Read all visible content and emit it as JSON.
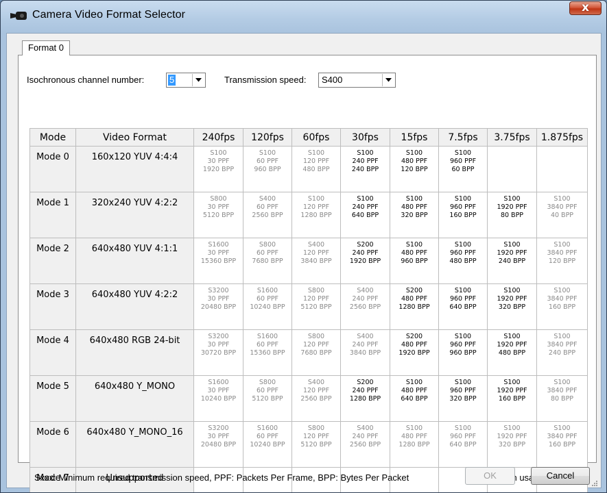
{
  "window": {
    "title": "Camera Video Format Selector",
    "close_glyph": "x"
  },
  "tabs": [
    {
      "label": "Format 0"
    }
  ],
  "isochronous": {
    "label": "Isochronous channel number:",
    "value": "5"
  },
  "transmission": {
    "label": "Transmission speed:",
    "value": "S400"
  },
  "table": {
    "headers": [
      "Mode",
      "Video Format",
      "240fps",
      "120fps",
      "60fps",
      "30fps",
      "15fps",
      "7.5fps",
      "3.75fps",
      "1.875fps"
    ],
    "rows": [
      {
        "mode": "Mode 0",
        "format": "160x120 YUV 4:4:4",
        "cells": [
          {
            "speed": "S100",
            "ppf": "30 PPF",
            "bpp": "1920 BPP",
            "supported": false
          },
          {
            "speed": "S100",
            "ppf": "60 PPF",
            "bpp": "960 BPP",
            "supported": false
          },
          {
            "speed": "S100",
            "ppf": "120 PPF",
            "bpp": "480 BPP",
            "supported": false
          },
          {
            "speed": "S100",
            "ppf": "240 PPF",
            "bpp": "240 BPP",
            "supported": true
          },
          {
            "speed": "S100",
            "ppf": "480 PPF",
            "bpp": "120 BPP",
            "supported": true
          },
          {
            "speed": "S100",
            "ppf": "960 PPF",
            "bpp": "60 BPP",
            "supported": true
          },
          null,
          null
        ]
      },
      {
        "mode": "Mode 1",
        "format": "320x240 YUV 4:2:2",
        "cells": [
          {
            "speed": "S800",
            "ppf": "30 PPF",
            "bpp": "5120 BPP",
            "supported": false
          },
          {
            "speed": "S400",
            "ppf": "60 PPF",
            "bpp": "2560 BPP",
            "supported": false
          },
          {
            "speed": "S100",
            "ppf": "120 PPF",
            "bpp": "1280 BPP",
            "supported": false
          },
          {
            "speed": "S100",
            "ppf": "240 PPF",
            "bpp": "640 BPP",
            "supported": true
          },
          {
            "speed": "S100",
            "ppf": "480 PPF",
            "bpp": "320 BPP",
            "supported": true
          },
          {
            "speed": "S100",
            "ppf": "960 PPF",
            "bpp": "160 BPP",
            "supported": true
          },
          {
            "speed": "S100",
            "ppf": "1920 PPF",
            "bpp": "80 BPP",
            "supported": true
          },
          {
            "speed": "S100",
            "ppf": "3840 PPF",
            "bpp": "40 BPP",
            "supported": false
          }
        ]
      },
      {
        "mode": "Mode 2",
        "format": "640x480 YUV 4:1:1",
        "cells": [
          {
            "speed": "S1600",
            "ppf": "30 PPF",
            "bpp": "15360 BPP",
            "supported": false
          },
          {
            "speed": "S800",
            "ppf": "60 PPF",
            "bpp": "7680 BPP",
            "supported": false
          },
          {
            "speed": "S400",
            "ppf": "120 PPF",
            "bpp": "3840 BPP",
            "supported": false
          },
          {
            "speed": "S200",
            "ppf": "240 PPF",
            "bpp": "1920 BPP",
            "supported": true
          },
          {
            "speed": "S100",
            "ppf": "480 PPF",
            "bpp": "960 BPP",
            "supported": true
          },
          {
            "speed": "S100",
            "ppf": "960 PPF",
            "bpp": "480 BPP",
            "supported": true
          },
          {
            "speed": "S100",
            "ppf": "1920 PPF",
            "bpp": "240 BPP",
            "supported": true
          },
          {
            "speed": "S100",
            "ppf": "3840 PPF",
            "bpp": "120 BPP",
            "supported": false
          }
        ]
      },
      {
        "mode": "Mode 3",
        "format": "640x480 YUV 4:2:2",
        "cells": [
          {
            "speed": "S3200",
            "ppf": "30 PPF",
            "bpp": "20480 BPP",
            "supported": false
          },
          {
            "speed": "S1600",
            "ppf": "60 PPF",
            "bpp": "10240 BPP",
            "supported": false
          },
          {
            "speed": "S800",
            "ppf": "120 PPF",
            "bpp": "5120 BPP",
            "supported": false
          },
          {
            "speed": "S400",
            "ppf": "240 PPF",
            "bpp": "2560 BPP",
            "supported": false
          },
          {
            "speed": "S200",
            "ppf": "480 PPF",
            "bpp": "1280 BPP",
            "supported": true
          },
          {
            "speed": "S100",
            "ppf": "960 PPF",
            "bpp": "640 BPP",
            "supported": true
          },
          {
            "speed": "S100",
            "ppf": "1920 PPF",
            "bpp": "320 BPP",
            "supported": true
          },
          {
            "speed": "S100",
            "ppf": "3840 PPF",
            "bpp": "160 BPP",
            "supported": false
          }
        ]
      },
      {
        "mode": "Mode 4",
        "format": "640x480 RGB 24-bit",
        "cells": [
          {
            "speed": "S3200",
            "ppf": "30 PPF",
            "bpp": "30720 BPP",
            "supported": false
          },
          {
            "speed": "S1600",
            "ppf": "60 PPF",
            "bpp": "15360 BPP",
            "supported": false
          },
          {
            "speed": "S800",
            "ppf": "120 PPF",
            "bpp": "7680 BPP",
            "supported": false
          },
          {
            "speed": "S400",
            "ppf": "240 PPF",
            "bpp": "3840 BPP",
            "supported": false
          },
          {
            "speed": "S200",
            "ppf": "480 PPF",
            "bpp": "1920 BPP",
            "supported": true
          },
          {
            "speed": "S100",
            "ppf": "960 PPF",
            "bpp": "960 BPP",
            "supported": true
          },
          {
            "speed": "S100",
            "ppf": "1920 PPF",
            "bpp": "480 BPP",
            "supported": true
          },
          {
            "speed": "S100",
            "ppf": "3840 PPF",
            "bpp": "240 BPP",
            "supported": false
          }
        ]
      },
      {
        "mode": "Mode 5",
        "format": "640x480 Y_MONO",
        "cells": [
          {
            "speed": "S1600",
            "ppf": "30 PPF",
            "bpp": "10240 BPP",
            "supported": false
          },
          {
            "speed": "S800",
            "ppf": "60 PPF",
            "bpp": "5120 BPP",
            "supported": false
          },
          {
            "speed": "S400",
            "ppf": "120 PPF",
            "bpp": "2560 BPP",
            "supported": false
          },
          {
            "speed": "S200",
            "ppf": "240 PPF",
            "bpp": "1280 BPP",
            "supported": true
          },
          {
            "speed": "S100",
            "ppf": "480 PPF",
            "bpp": "640 BPP",
            "supported": true
          },
          {
            "speed": "S100",
            "ppf": "960 PPF",
            "bpp": "320 BPP",
            "supported": true
          },
          {
            "speed": "S100",
            "ppf": "1920 PPF",
            "bpp": "160 BPP",
            "supported": true
          },
          {
            "speed": "S100",
            "ppf": "3840 PPF",
            "bpp": "80 BPP",
            "supported": false
          }
        ]
      },
      {
        "mode": "Mode 6",
        "format": "640x480 Y_MONO_16",
        "cells": [
          {
            "speed": "S3200",
            "ppf": "30 PPF",
            "bpp": "20480 BPP",
            "supported": false
          },
          {
            "speed": "S1600",
            "ppf": "60 PPF",
            "bpp": "10240 BPP",
            "supported": false
          },
          {
            "speed": "S800",
            "ppf": "120 PPF",
            "bpp": "5120 BPP",
            "supported": false
          },
          {
            "speed": "S400",
            "ppf": "240 PPF",
            "bpp": "2560 BPP",
            "supported": false
          },
          {
            "speed": "S100",
            "ppf": "480 PPF",
            "bpp": "1280 BPP",
            "supported": false
          },
          {
            "speed": "S100",
            "ppf": "960 PPF",
            "bpp": "640 BPP",
            "supported": false
          },
          {
            "speed": "S100",
            "ppf": "1920 PPF",
            "bpp": "320 BPP",
            "supported": false
          },
          {
            "speed": "S100",
            "ppf": "3840 PPF",
            "bpp": "160 BPP",
            "supported": false
          }
        ]
      },
      {
        "mode": "Mode 7",
        "format": "Unsupported",
        "cells": [
          null,
          null,
          null,
          null,
          null,
          null,
          null,
          null
        ]
      }
    ]
  },
  "footer": {
    "legend": "Sxxx: Minimum required transmission speed, PPF: Packets Per Frame, BPP: Bytes Per Packet",
    "bandwidth": "Bandwidth usage: 0.0%"
  },
  "buttons": {
    "ok": "OK",
    "cancel": "Cancel"
  },
  "colors": {
    "supported_text": "#000000",
    "unsupported_text": "#8a8a8a",
    "selection": "#3399ff",
    "close_button": "#c7391b"
  },
  "icons": {
    "app": "camera-icon",
    "close": "close-icon",
    "dropdown": "chevron-down-icon"
  }
}
